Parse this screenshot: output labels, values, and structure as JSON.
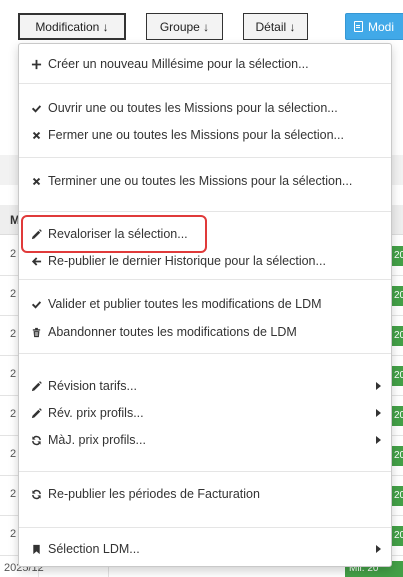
{
  "toolbar": {
    "buttons": [
      {
        "label": "Modification ↓"
      },
      {
        "label": "Groupe ↓"
      },
      {
        "label": "Détail ↓"
      },
      {
        "label": "Modi"
      }
    ]
  },
  "background": {
    "header_cell": "M",
    "row_cells": [
      "2",
      "2",
      "2",
      "2",
      "2",
      "2",
      "2",
      "2"
    ],
    "badge_text": "20",
    "last_row_cell": "2025/12",
    "last_row_badge": "Mil. 20"
  },
  "menu": {
    "items": [
      {
        "icon": "plus-icon",
        "label": "Créer un nouveau Millésime pour la sélection..."
      },
      {
        "icon": "check-icon",
        "label": "Ouvrir une ou toutes les Missions pour la sélection..."
      },
      {
        "icon": "cross-icon",
        "label": "Fermer une ou toutes les Missions pour la sélection..."
      },
      {
        "icon": "cross-icon",
        "label": "Terminer une ou toutes les Missions pour la sélection..."
      },
      {
        "icon": "pencil-icon",
        "label": "Revaloriser la sélection..."
      },
      {
        "icon": "arrow-left-icon",
        "label": "Re-publier le dernier Historique pour la sélection..."
      },
      {
        "icon": "check-icon",
        "label": "Valider et publier toutes les modifications de LDM"
      },
      {
        "icon": "trash-icon",
        "label": "Abandonner toutes les modifications de LDM"
      },
      {
        "icon": "pencil-icon",
        "label": "Révision tarifs..."
      },
      {
        "icon": "pencil-icon",
        "label": "Rév. prix profils..."
      },
      {
        "icon": "refresh-icon",
        "label": "MàJ. prix profils..."
      },
      {
        "icon": "refresh-icon",
        "label": "Re-publier les périodes de Facturation"
      },
      {
        "icon": "bookmark-icon",
        "label": "Sélection LDM..."
      }
    ]
  }
}
